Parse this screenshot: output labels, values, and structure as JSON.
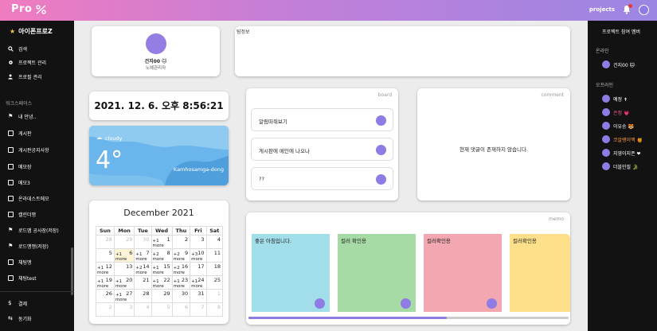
{
  "header": {
    "logo_text": "Pro",
    "projects_label": "projects",
    "accent_gradient": [
      "#f07bbf",
      "#9b86e3"
    ]
  },
  "sidebar": {
    "workspace_title": "아이폰프로Z",
    "main_items": [
      {
        "label": "검색",
        "icon": "search-icon"
      },
      {
        "label": "프로젝트 관리",
        "icon": "gear-icon"
      },
      {
        "label": "프로필 관리",
        "icon": "user-icon"
      }
    ],
    "section_label": "워크스페이스",
    "workspace_items": [
      {
        "label": "내 안녕..",
        "icon": "flag-icon"
      },
      {
        "label": "게시판",
        "icon": "document-icon"
      },
      {
        "label": "게시판공지사항",
        "icon": "document-icon"
      },
      {
        "label": "메모장",
        "icon": "document-icon"
      },
      {
        "label": "메모3",
        "icon": "document-icon"
      },
      {
        "label": "온라데스트메모",
        "icon": "document-icon"
      },
      {
        "label": "캘린더맹",
        "icon": "document-icon"
      },
      {
        "label": "로드맵 공사장(저장)",
        "icon": "flag-icon"
      },
      {
        "label": "로드맹맹(저장)",
        "icon": "flag-icon"
      },
      {
        "label": "채팅맹",
        "icon": "document-icon"
      },
      {
        "label": "채팅test",
        "icon": "document-icon"
      }
    ],
    "bottom_items": [
      {
        "label": "결제",
        "icon": "dollar-icon"
      },
      {
        "label": "동기화",
        "icon": "sync-icon"
      }
    ]
  },
  "profile": {
    "name": "건지00 🐱",
    "role": "노예관리자"
  },
  "notice": {
    "label": "팀정보"
  },
  "clock": {
    "text": "2021. 12. 6. 오후 8:56:21"
  },
  "weather": {
    "description": "cloudy",
    "temperature": "4°",
    "location": "Kamhosamga-dong"
  },
  "calendar": {
    "title": "December 2021",
    "weekdays": [
      "Sun",
      "Mon",
      "Tue",
      "Wed",
      "Thu",
      "Fri",
      "Sat"
    ],
    "weeks": [
      [
        {
          "d": "28",
          "m": true
        },
        {
          "d": "29",
          "m": true
        },
        {
          "d": "30",
          "m": true
        },
        {
          "d": "1",
          "x": "+1\nmore"
        },
        {
          "d": "2"
        },
        {
          "d": "3"
        },
        {
          "d": "4"
        }
      ],
      [
        {
          "d": "5"
        },
        {
          "d": "6",
          "t": true,
          "x": "+1\nmore"
        },
        {
          "d": "7",
          "x": "+1\nmore"
        },
        {
          "d": "8",
          "x": "+2\nmore"
        },
        {
          "d": "9",
          "x": "+2\nmore"
        },
        {
          "d": "10",
          "x": "+3\nmore"
        },
        {
          "d": "11"
        }
      ],
      [
        {
          "d": "12",
          "x": "+1\nmore"
        },
        {
          "d": "13"
        },
        {
          "d": "14",
          "x": "+2\nmore"
        },
        {
          "d": "15",
          "x": "+1\nmore"
        },
        {
          "d": "16",
          "x": "+2\nmore"
        },
        {
          "d": "17"
        },
        {
          "d": "18"
        }
      ],
      [
        {
          "d": "19",
          "x": "+1\nmore"
        },
        {
          "d": "20",
          "x": "+1\nmore"
        },
        {
          "d": "21"
        },
        {
          "d": "22",
          "x": "+1\nmore"
        },
        {
          "d": "23",
          "x": "+1\nmore"
        },
        {
          "d": "24",
          "x": "+1\nmore"
        },
        {
          "d": "25"
        }
      ],
      [
        {
          "d": "26"
        },
        {
          "d": "27",
          "x": "+1\nmore"
        },
        {
          "d": "28"
        },
        {
          "d": "29"
        },
        {
          "d": "30"
        },
        {
          "d": "31"
        },
        {
          "d": "1",
          "m": true
        }
      ],
      [
        {
          "d": "2",
          "m": true
        },
        {
          "d": "3",
          "m": true
        },
        {
          "d": "4",
          "m": true
        },
        {
          "d": "5",
          "m": true
        },
        {
          "d": "6",
          "m": true
        },
        {
          "d": "7",
          "m": true
        },
        {
          "d": "8",
          "m": true
        }
      ]
    ]
  },
  "board": {
    "label": "board",
    "items": [
      "알림떠줘보기",
      "게시판에 메인에 나오나",
      "??"
    ]
  },
  "comment": {
    "label": "comment",
    "empty_text": "현재 댓글이 존재하지 않습니다."
  },
  "memo": {
    "label": "memo",
    "notes": [
      {
        "text": "좋은 아침입니다.",
        "color": "#a1deea"
      },
      {
        "text": "컬러 확인용",
        "color": "#a6dba5"
      },
      {
        "text": "컬러확인용",
        "color": "#f3a7b1"
      },
      {
        "text": "컬러확인용",
        "color": "#ffe08a"
      }
    ],
    "scroll_fraction": 0.62
  },
  "members": {
    "title": "프로젝트 참여 멤버",
    "online_label": "온라인",
    "online": [
      {
        "name": "건지00 🐱",
        "color": "#ffffff"
      }
    ],
    "offline_label": "오프라인",
    "offline": [
      {
        "name": "예정 ✝",
        "color": "#ffffff"
      },
      {
        "name": "은정 💗",
        "color": "#f06292"
      },
      {
        "name": "이유송 🐯",
        "color": "#ffffff"
      },
      {
        "name": "코알랭이맥 🍯",
        "color": "#ff9f43"
      },
      {
        "name": "지영이지존 ❤",
        "color": "#ffffff"
      },
      {
        "name": "더블인필 🐊",
        "color": "#ffffff"
      }
    ]
  }
}
